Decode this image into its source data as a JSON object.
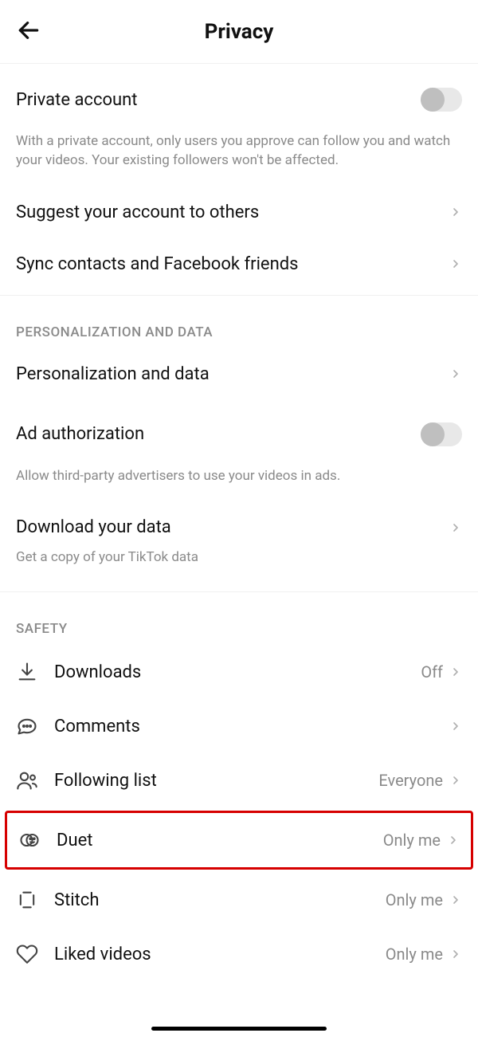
{
  "header": {
    "title": "Privacy"
  },
  "privateAccount": {
    "label": "Private account",
    "description": "With a private account, only users you approve can follow you and watch your videos. Your existing followers won't be affected.",
    "enabled": false
  },
  "rows": {
    "suggest": {
      "label": "Suggest your account to others"
    },
    "sync": {
      "label": "Sync contacts and Facebook friends"
    }
  },
  "sections": {
    "personalization": {
      "header": "PERSONALIZATION AND DATA",
      "personalization": {
        "label": "Personalization and data"
      },
      "adAuth": {
        "label": "Ad authorization",
        "description": "Allow third-party advertisers to use your videos in ads.",
        "enabled": false
      },
      "download": {
        "label": "Download your data",
        "description": "Get a copy of your TikTok data"
      }
    },
    "safety": {
      "header": "SAFETY",
      "downloads": {
        "label": "Downloads",
        "value": "Off"
      },
      "comments": {
        "label": "Comments"
      },
      "following": {
        "label": "Following list",
        "value": "Everyone"
      },
      "duet": {
        "label": "Duet",
        "value": "Only me"
      },
      "stitch": {
        "label": "Stitch",
        "value": "Only me"
      },
      "liked": {
        "label": "Liked videos",
        "value": "Only me"
      }
    }
  }
}
